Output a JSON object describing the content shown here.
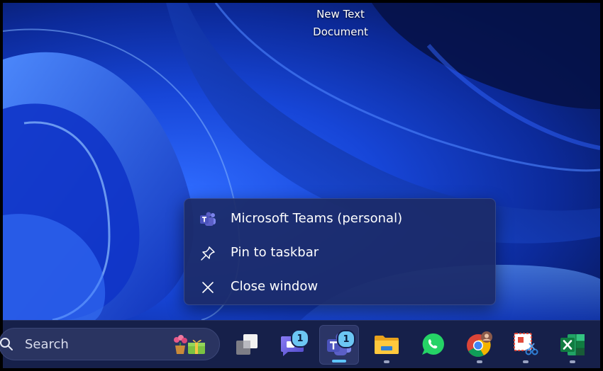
{
  "desktop": {
    "icon_label_line1": "New Text",
    "icon_label_line2": "Document"
  },
  "context_menu": {
    "items": [
      {
        "label": "Microsoft Teams (personal)",
        "icon": "teams-icon"
      },
      {
        "label": "Pin to taskbar",
        "icon": "pin-icon"
      },
      {
        "label": "Close window",
        "icon": "close-icon"
      }
    ]
  },
  "taskbar": {
    "search": {
      "placeholder": "Search",
      "icon": "search-icon"
    },
    "apps": [
      {
        "name": "task-view",
        "icon": "task-view-icon"
      },
      {
        "name": "teams-meet",
        "icon": "teams-meet-icon",
        "badge": "1"
      },
      {
        "name": "teams",
        "icon": "teams-icon",
        "badge": "1",
        "active": true
      },
      {
        "name": "file-explorer",
        "icon": "folder-icon"
      },
      {
        "name": "whatsapp",
        "icon": "whatsapp-icon"
      },
      {
        "name": "chrome",
        "icon": "chrome-icon"
      },
      {
        "name": "snipping-tool",
        "icon": "snipping-tool-icon"
      },
      {
        "name": "excel",
        "icon": "excel-icon"
      }
    ]
  },
  "colors": {
    "taskbar_bg": "#16204a",
    "menu_bg": "#1c2b68",
    "accent": "#5ec4ff",
    "badge": "#6cc6f3"
  }
}
